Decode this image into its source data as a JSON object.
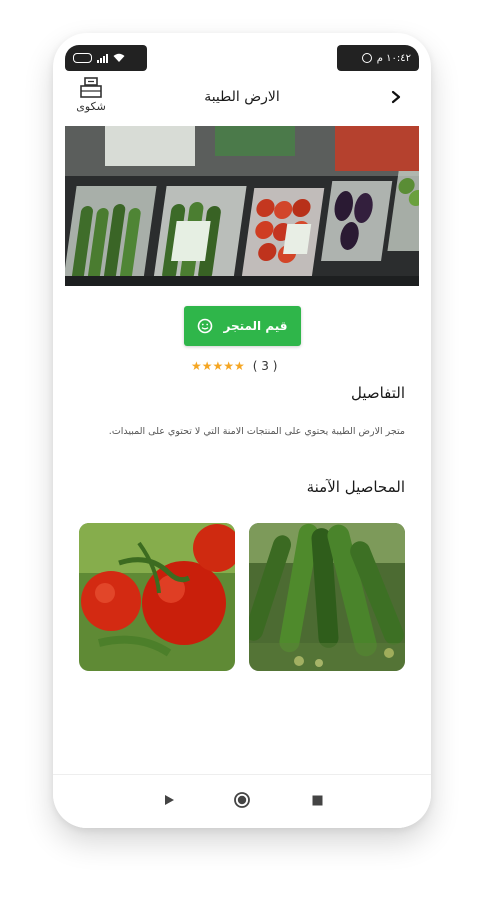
{
  "status_bar": {
    "time": "١٠:٤٢ م",
    "battery_icon": "battery-icon",
    "signal_icon": "signal-icon",
    "wifi_icon": "wifi-icon",
    "whatsapp_icon": "whatsapp-icon"
  },
  "header": {
    "title": "الارض الطيبة",
    "complaint_label": "شكوى",
    "complaint_icon": "complaint-box-icon",
    "back_icon": "chevron-right-icon"
  },
  "store": {
    "rate_button_label": "قيم المتجر",
    "rate_icon": "smiley-icon",
    "stars": "★★★★★",
    "rating_count": "( 3 )"
  },
  "details": {
    "title": "التفاصيل",
    "text": "متجر الارض الطيبة يحتوي على المنتجات الامنة التي لا تحتوي على المبيدات."
  },
  "crops": {
    "title": "المحاصيل الآمنة",
    "items": [
      {
        "name": "cucumber-image"
      },
      {
        "name": "tomato-image"
      }
    ]
  },
  "navbar": {
    "back_icon": "triangle-back-icon",
    "home_icon": "circle-home-icon",
    "recents_icon": "square-recents-icon"
  },
  "colors": {
    "accent": "#2fb64a",
    "star": "#f5a623"
  }
}
